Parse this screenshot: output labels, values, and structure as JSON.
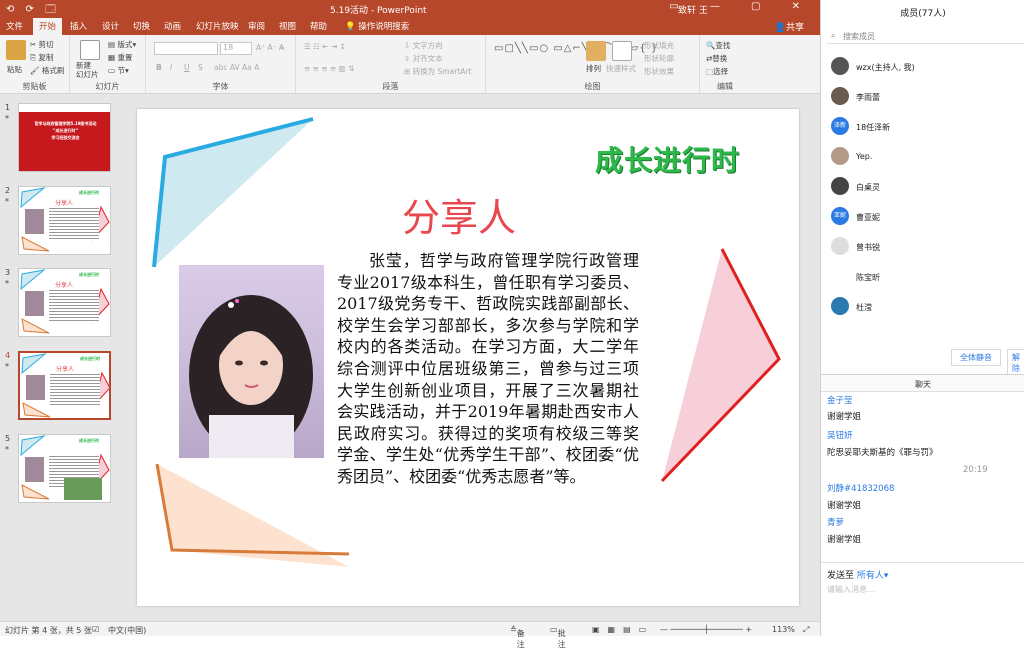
{
  "window": {
    "title": "5.19活动 - PowerPoint",
    "user": "致轩 王",
    "share": "共享",
    "quick_access": "⟲ ⟳ 🗔"
  },
  "tabs": [
    "文件",
    "开始",
    "插入",
    "设计",
    "切换",
    "动画",
    "幻灯片放映",
    "审阅",
    "视图",
    "帮助",
    "操作说明搜索"
  ],
  "ribbon": {
    "clipboard": {
      "label": "剪贴板",
      "paste": "粘贴",
      "cut": "剪切",
      "copy": "复制",
      "format_painter": "格式刷"
    },
    "slides": {
      "label": "幻灯片",
      "new_slide": "新建\n幻灯片",
      "layout": "版式",
      "reset": "重置",
      "section": "节"
    },
    "font": {
      "label": "字体",
      "size": "18",
      "bold": "B",
      "italic": "I",
      "underline": "U",
      "strike": "S"
    },
    "paragraph": {
      "label": "段落",
      "text_direction": "文字方向",
      "align_text": "对齐文本",
      "smartart": "转换为 SmartArt"
    },
    "drawing": {
      "label": "绘图",
      "arrange": "排列",
      "quick_styles": "快速样式",
      "shape_fill": "形状填充",
      "shape_outline": "形状轮廓",
      "shape_effects": "形状效果"
    },
    "editing": {
      "label": "编辑",
      "find": "查找",
      "replace": "替换",
      "select": "选择"
    }
  },
  "thumbnails": [
    {
      "num": "1",
      "star": "*",
      "line1": "哲学与政府管理学院5.19图书活动",
      "line2": "“成长进行时”",
      "line3": "学习经验交流会"
    },
    {
      "num": "2",
      "star": "*",
      "title": "分享人",
      "tag": "成长进行时"
    },
    {
      "num": "3",
      "star": "*",
      "title": "分享人",
      "tag": "成长进行时"
    },
    {
      "num": "4",
      "star": "*",
      "title": "分享人",
      "tag": "成长进行时"
    },
    {
      "num": "5",
      "star": "*",
      "tag": "成长进行时"
    }
  ],
  "selected_slide": "4",
  "slide": {
    "title": "成长进行时",
    "heading": "分享人",
    "body": "张莹，哲学与政府管理学院行政管理专业2017级本科生，曾任职有学习委员、2017级党务专干、哲政院实践部副部长、校学生会学习部部长，多次参与学院和学校内的各类活动。在学习方面，大二学年综合测评中位居班级第三，曾参与过三项大学生创新创业项目，开展了三次暑期社会实践活动，并于2019年暑期赴西安市人民政府实习。获得过的奖项有校级三等奖学金、学生处“优秀学生干部”、校团委“优秀团员”、校团委“优秀志愿者”等。",
    "colors": {
      "blue": "#29abe2",
      "red": "#e02020",
      "orange": "#d77b3a",
      "green": "#2db84a"
    }
  },
  "status": {
    "slide_info": "幻灯片 第 4 张，共 5 张",
    "language": "中文(中国)",
    "notes": "备注",
    "comments": "批注",
    "zoom": "113%"
  },
  "members_panel": {
    "header": "成员(77人)",
    "search_placeholder": "搜索成员",
    "members": [
      {
        "name": "wzx(主持人, 我)",
        "avatar": ""
      },
      {
        "name": "李雨蕾",
        "avatar": ""
      },
      {
        "name": "18任泽新",
        "avatar": "泽新"
      },
      {
        "name": "Yep.",
        "avatar": ""
      },
      {
        "name": "白桌灵",
        "avatar": ""
      },
      {
        "name": "曹亚妮",
        "avatar": "亚妮"
      },
      {
        "name": "曾书锐",
        "avatar": ""
      },
      {
        "name": "陈宝昕",
        "avatar": ""
      },
      {
        "name": "杜滢",
        "avatar": ""
      }
    ],
    "mute_all": "全体静音",
    "unmute": "解除"
  },
  "chat": {
    "header": "聊天",
    "messages": [
      {
        "name": "金子莹",
        "text": "谢谢学姐"
      },
      {
        "name": "吴钮妍",
        "text": "陀思妥耶夫斯基的《罪与罚》"
      },
      {
        "time": "20:19"
      },
      {
        "name": "刘静#41832068",
        "text": "谢谢学姐"
      },
      {
        "name": "青萝",
        "text": "谢谢学姐"
      }
    ],
    "send_to_label": "发送至",
    "send_to_target": "所有人",
    "input_placeholder": "请输入消息..."
  }
}
